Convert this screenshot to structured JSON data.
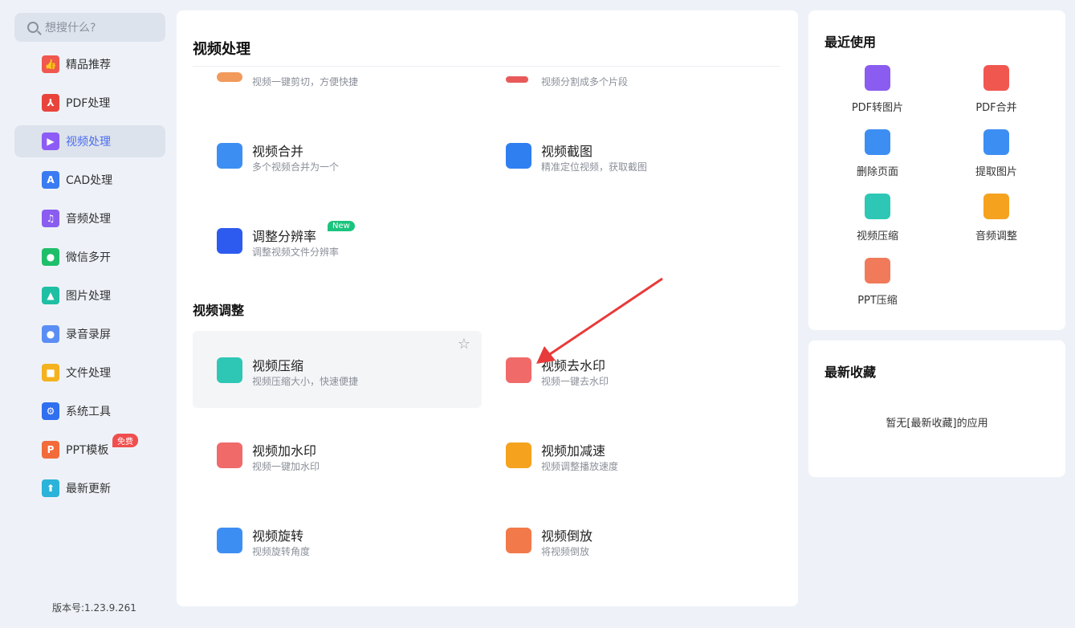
{
  "search": {
    "placeholder": "想搜什么?"
  },
  "sidebar": {
    "items": [
      {
        "label": "精品推荐",
        "icon": "thumbs-up-icon",
        "color": "#f0574f"
      },
      {
        "label": "PDF处理",
        "icon": "pdf-icon",
        "color": "#e8443b"
      },
      {
        "label": "视频处理",
        "icon": "video-play-icon",
        "color": "#8d5cf6"
      },
      {
        "label": "CAD处理",
        "icon": "cad-icon",
        "color": "#3a7bf2"
      },
      {
        "label": "音频处理",
        "icon": "music-note-icon",
        "color": "#8a5cf0"
      },
      {
        "label": "微信多开",
        "icon": "wechat-icon",
        "color": "#1fbf6a"
      },
      {
        "label": "图片处理",
        "icon": "image-icon",
        "color": "#1fbfa4"
      },
      {
        "label": "录音录屏",
        "icon": "microphone-icon",
        "color": "#5b8ef5"
      },
      {
        "label": "文件处理",
        "icon": "folder-icon",
        "color": "#f5b21f"
      },
      {
        "label": "系统工具",
        "icon": "gear-icon",
        "color": "#2f6ff0"
      },
      {
        "label": "PPT模板",
        "icon": "ppt-icon",
        "color": "#f26b3a",
        "badge": "免费"
      },
      {
        "label": "最新更新",
        "icon": "upload-icon",
        "color": "#2bb3d9"
      }
    ],
    "version": "版本号:1.23.9.261"
  },
  "main": {
    "section1_title": "视频处理",
    "section2_title": "视频调整",
    "tools": [
      {
        "name": "",
        "desc": "视频一键剪切，方便快捷",
        "icon": "scissors-icon",
        "color": "#f29a5c"
      },
      {
        "name": "",
        "desc": "视频分割成多个片段",
        "icon": "split-icon",
        "color": "#e85a5a"
      },
      {
        "name": "视频合并",
        "desc": "多个视频合并为一个",
        "icon": "video-merge-icon",
        "color": "#3d8ef2"
      },
      {
        "name": "视频截图",
        "desc": "精准定位视频，获取截图",
        "icon": "crop-image-icon",
        "color": "#2f7ff0"
      },
      {
        "name": "调整分辨率",
        "desc": "调整视频文件分辨率",
        "icon": "resolution-icon",
        "color": "#2d5bf0",
        "badge": "New"
      },
      {
        "name": "视频压缩",
        "desc": "视频压缩大小，快速便捷",
        "icon": "compress-icon",
        "color": "#2ec7b5"
      },
      {
        "name": "视频去水印",
        "desc": "视频一键去水印",
        "icon": "remove-watermark-icon",
        "color": "#f06a6a"
      },
      {
        "name": "视频加水印",
        "desc": "视频一键加水印",
        "icon": "add-watermark-icon",
        "color": "#f06a6a"
      },
      {
        "name": "视频加减速",
        "desc": "视频调整播放速度",
        "icon": "speed-icon",
        "color": "#f5a21f"
      },
      {
        "name": "视频旋转",
        "desc": "视频旋转角度",
        "icon": "rotate-icon",
        "color": "#3d8ef2"
      },
      {
        "name": "视频倒放",
        "desc": "将视频倒放",
        "icon": "reverse-icon",
        "color": "#f27a4a"
      }
    ]
  },
  "recent": {
    "title": "最近使用",
    "items": [
      {
        "label": "PDF转图片",
        "icon": "pdf-to-image-icon",
        "color": "#8a5cf0"
      },
      {
        "label": "PDF合并",
        "icon": "pdf-merge-icon",
        "color": "#f0574f"
      },
      {
        "label": "删除页面",
        "icon": "delete-page-icon",
        "color": "#3d8ef2"
      },
      {
        "label": "提取图片",
        "icon": "extract-image-icon",
        "color": "#3d8ef2"
      },
      {
        "label": "视频压缩",
        "icon": "compress-icon",
        "color": "#2ec7b5"
      },
      {
        "label": "音频调整",
        "icon": "speaker-icon",
        "color": "#f5a21f"
      },
      {
        "label": "PPT压缩",
        "icon": "ppt-compress-icon",
        "color": "#f07a5a"
      }
    ]
  },
  "favorites": {
    "title": "最新收藏",
    "empty_text": "暂无[最新收藏]的应用"
  }
}
